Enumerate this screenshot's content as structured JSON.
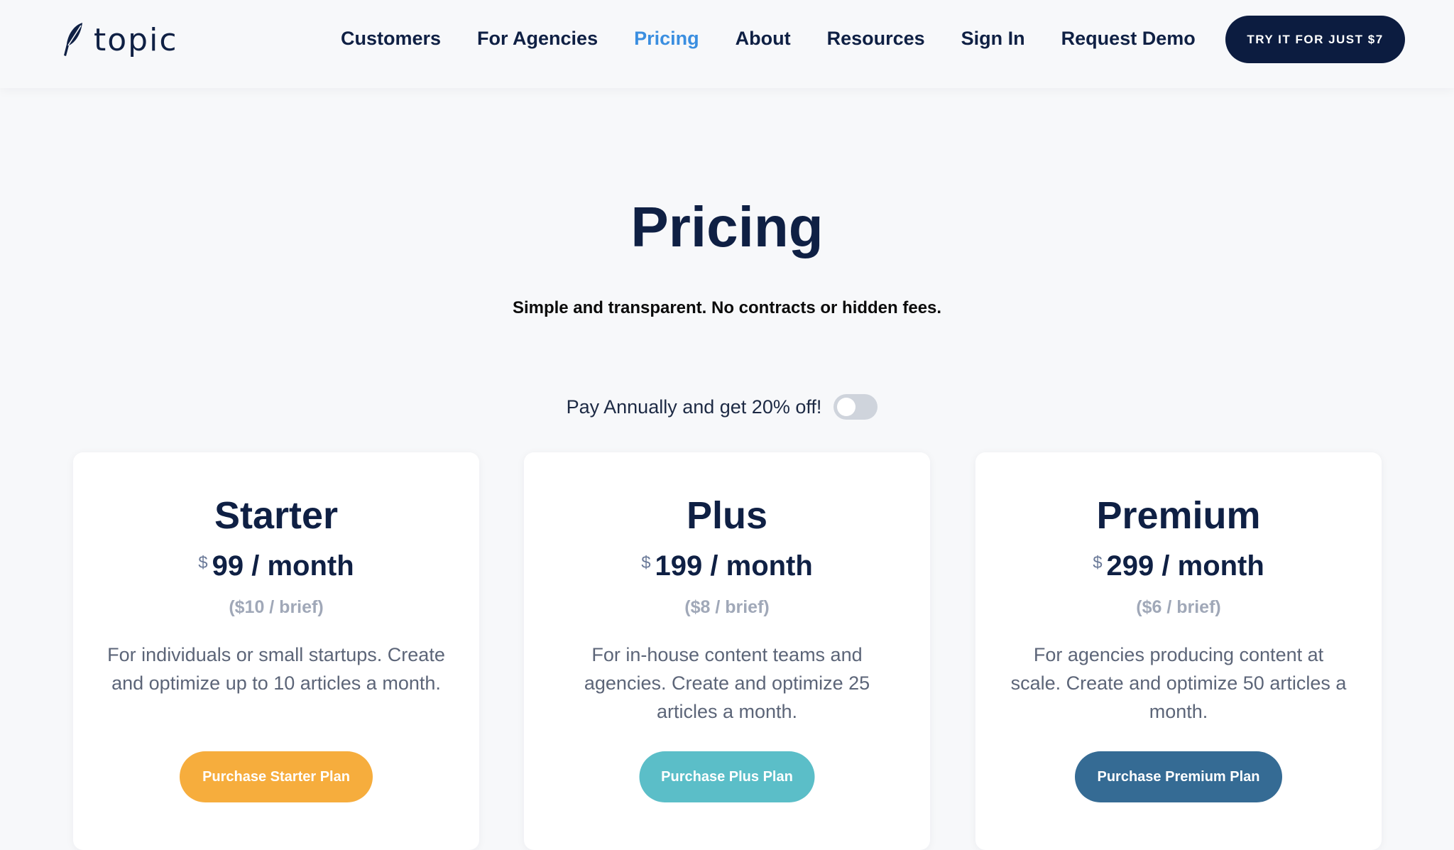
{
  "brand": {
    "name": "topic",
    "logo_icon": "feather-quill-icon"
  },
  "nav": {
    "items": [
      {
        "label": "Customers",
        "active": false
      },
      {
        "label": "For Agencies",
        "active": false
      },
      {
        "label": "Pricing",
        "active": true
      },
      {
        "label": "About",
        "active": false
      },
      {
        "label": "Resources",
        "active": false
      },
      {
        "label": "Sign In",
        "active": false
      },
      {
        "label": "Request Demo",
        "active": false
      }
    ],
    "cta_label": "TRY IT FOR JUST $7"
  },
  "hero": {
    "title": "Pricing",
    "subtitle": "Simple and transparent. No contracts or hidden fees."
  },
  "billing_toggle": {
    "label": "Pay Annually and get 20% off!",
    "enabled": false
  },
  "plans": [
    {
      "name": "Starter",
      "currency": "$",
      "price": "99 / month",
      "per_brief": "($10 / brief)",
      "description": "For individuals or small startups. Create and optimize up to 10 articles a month.",
      "button_label": "Purchase Starter Plan",
      "button_color": "#f6ad3d"
    },
    {
      "name": "Plus",
      "currency": "$",
      "price": "199 / month",
      "per_brief": "($8 / brief)",
      "description": "For in-house content teams and agencies. Create and optimize 25 articles a month.",
      "button_label": "Purchase Plus Plan",
      "button_color": "#5bbec8"
    },
    {
      "name": "Premium",
      "currency": "$",
      "price": "299 / month",
      "per_brief": "($6 / brief)",
      "description": "For agencies producing content at scale. Create and optimize 50 articles a month.",
      "button_label": "Purchase Premium Plan",
      "button_color": "#356b94"
    }
  ],
  "colors": {
    "navy": "#0f2044",
    "accent_blue": "#3a8ee0",
    "background": "#f7f8fa"
  }
}
